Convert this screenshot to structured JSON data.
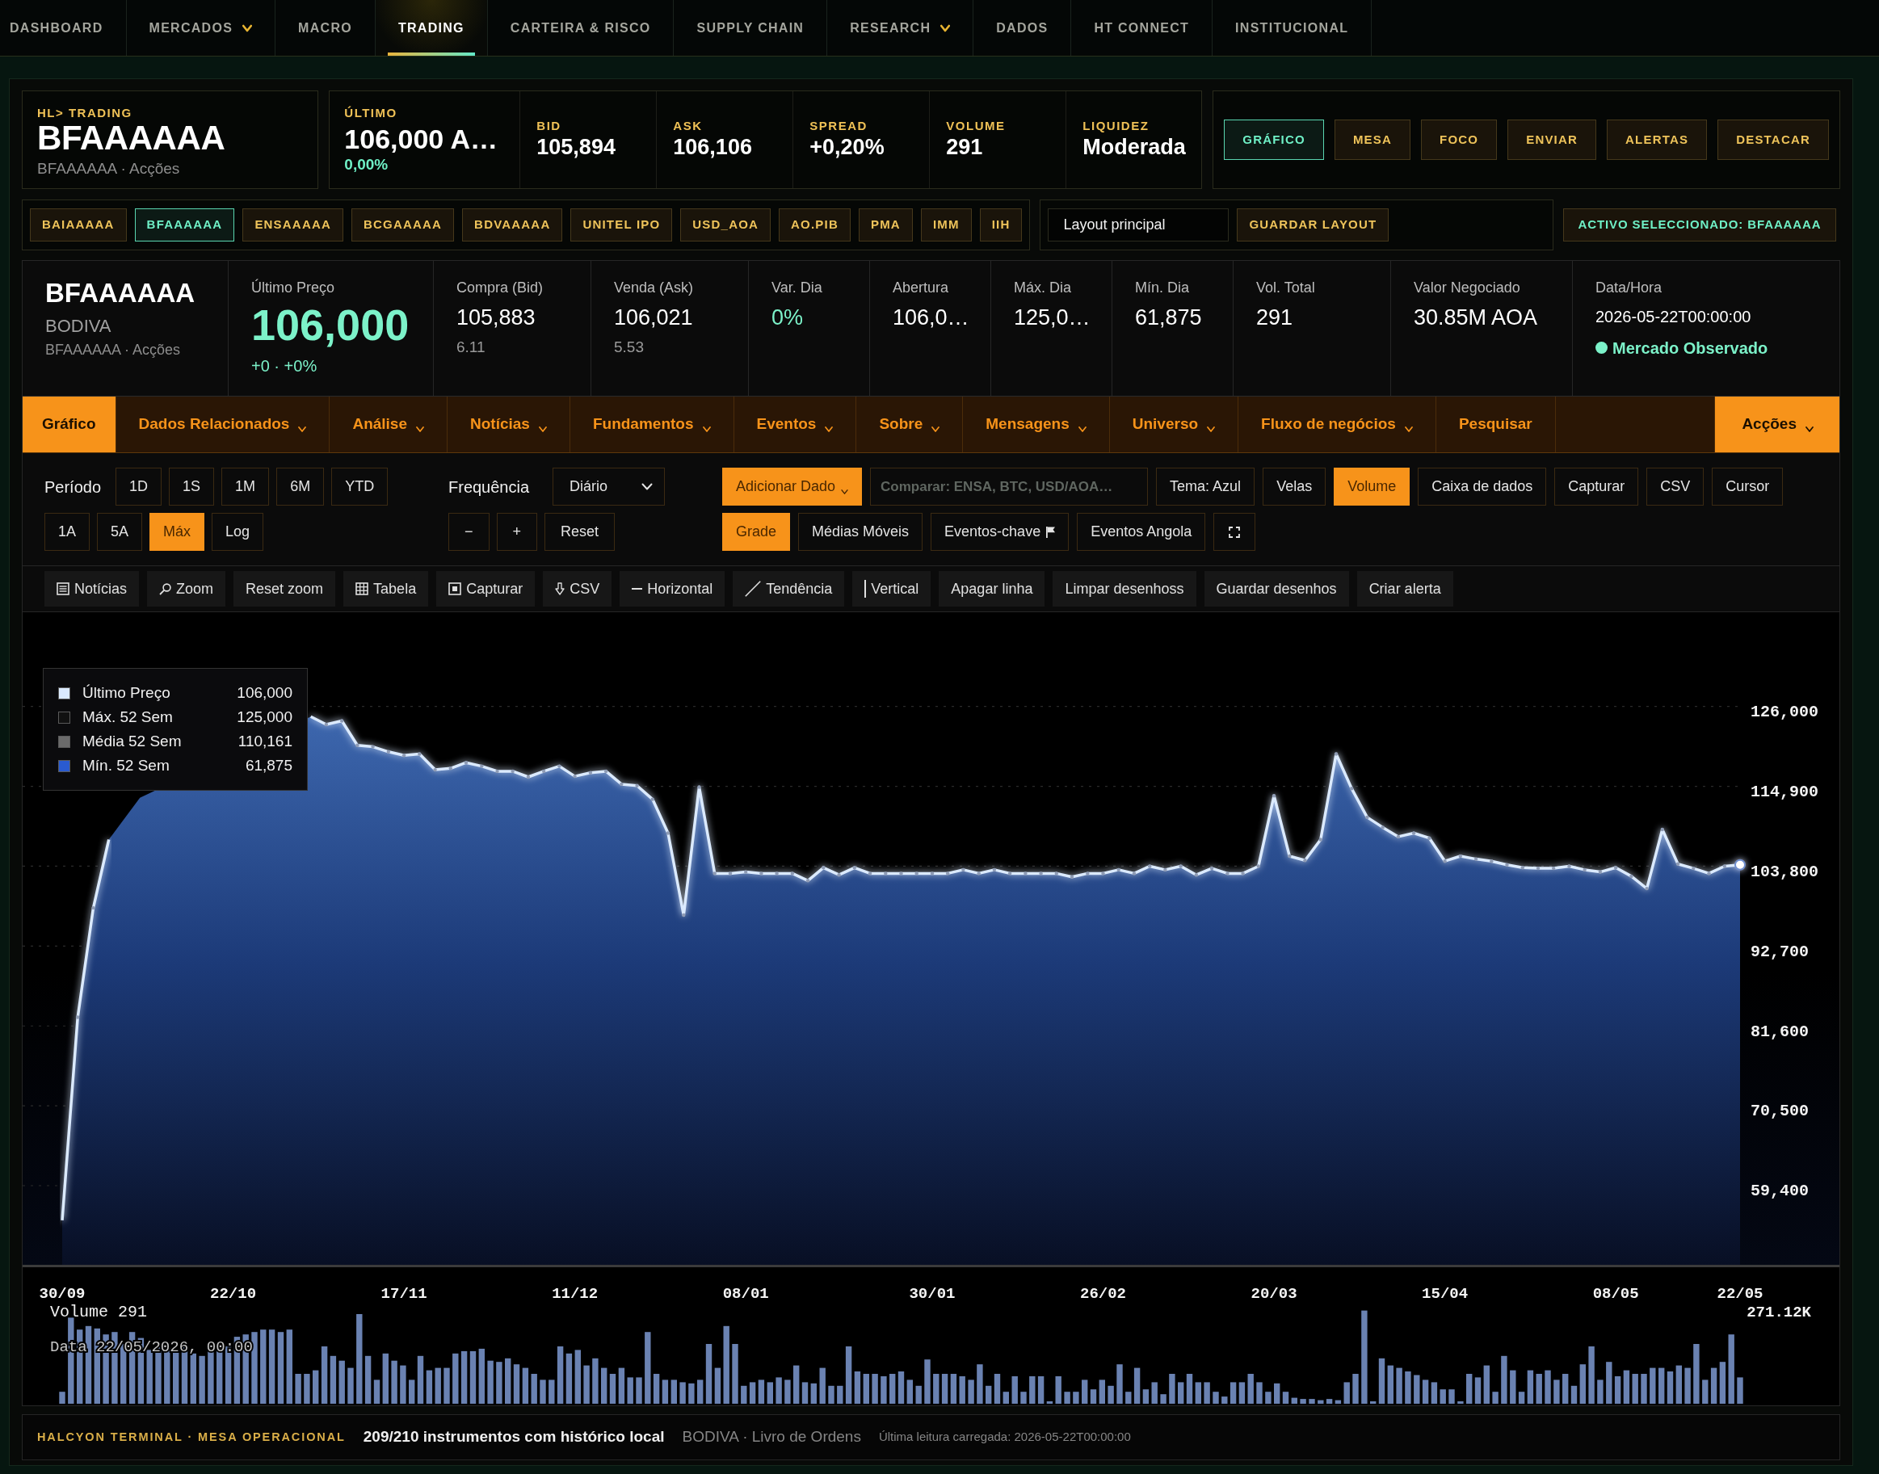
{
  "nav": [
    {
      "label": "DASHBOARD",
      "selected": false,
      "dropdown": false
    },
    {
      "label": "MERCADOS",
      "selected": false,
      "dropdown": true
    },
    {
      "label": "MACRO",
      "selected": false,
      "dropdown": false
    },
    {
      "label": "TRADING",
      "selected": true,
      "dropdown": false
    },
    {
      "label": "CARTEIRA & RISCO",
      "selected": false,
      "dropdown": false
    },
    {
      "label": "SUPPLY CHAIN",
      "selected": false,
      "dropdown": false
    },
    {
      "label": "RESEARCH",
      "selected": false,
      "dropdown": true
    },
    {
      "label": "DADOS",
      "selected": false,
      "dropdown": false
    },
    {
      "label": "HT CONNECT",
      "selected": false,
      "dropdown": false
    },
    {
      "label": "INSTITUCIONAL",
      "selected": false,
      "dropdown": false
    }
  ],
  "header": {
    "kicker": "HL> TRADING",
    "symbol": "BFAAAAAA",
    "subtitle": "BFAAAAAA · Acções"
  },
  "quote": [
    {
      "kind": "main",
      "label": "ÚLTIMO",
      "value": "106,000 A…",
      "change": "0,00%"
    },
    {
      "kind": "plain",
      "label": "BID",
      "value": "105,894"
    },
    {
      "kind": "plain",
      "label": "ASK",
      "value": "106,106"
    },
    {
      "kind": "plain",
      "label": "SPREAD",
      "value": "+0,20%"
    },
    {
      "kind": "plain",
      "label": "VOLUME",
      "value": "291"
    },
    {
      "kind": "plain",
      "label": "LIQUIDEZ",
      "value": "Moderada"
    }
  ],
  "view_buttons": [
    {
      "label": "GRÁFICO",
      "selected": true
    },
    {
      "label": "MESA",
      "selected": false
    },
    {
      "label": "FOCO",
      "selected": false
    },
    {
      "label": "ENVIAR",
      "selected": false
    },
    {
      "label": "ALERTAS",
      "selected": false
    },
    {
      "label": "DESTACAR",
      "selected": false
    }
  ],
  "tickers": [
    {
      "label": "BAIAAAAA",
      "selected": false
    },
    {
      "label": "BFAAAAAA",
      "selected": true
    },
    {
      "label": "ENSAAAAA",
      "selected": false
    },
    {
      "label": "BCGAAAAA",
      "selected": false
    },
    {
      "label": "BDVAAAAA",
      "selected": false
    },
    {
      "label": "UNITEL IPO",
      "selected": false
    },
    {
      "label": "USD_AOA",
      "selected": false
    },
    {
      "label": "AO.PIB",
      "selected": false
    },
    {
      "label": "PMA",
      "selected": false
    },
    {
      "label": "IMM",
      "selected": false
    },
    {
      "label": "IIH",
      "selected": false
    }
  ],
  "layout": {
    "name_field": {
      "value": "Layout principal"
    },
    "save_button": "GUARDAR LAYOUT"
  },
  "selected_asset": "ACTIVO SELECCIONADO: BFAAAAAA",
  "instrument": {
    "symbol": "BFAAAAAA",
    "exchange": "BODIVA",
    "subtitle": "BFAAAAAA · Acções"
  },
  "stats": [
    {
      "kind": "price",
      "label": "Último Preço",
      "value": "106,000",
      "sub": "+0 · +0%"
    },
    {
      "kind": "plain",
      "label": "Compra (Bid)",
      "value": "105,883",
      "sub": "6.11"
    },
    {
      "kind": "plain",
      "label": "Venda (Ask)",
      "value": "106,021",
      "sub": "5.53"
    },
    {
      "kind": "change",
      "label": "Var. Dia",
      "value": "0%"
    },
    {
      "kind": "plain",
      "label": "Abertura",
      "value": "106,0…"
    },
    {
      "kind": "plain",
      "label": "Máx. Dia",
      "value": "125,0…"
    },
    {
      "kind": "plain",
      "label": "Mín. Dia",
      "value": "61,875"
    },
    {
      "kind": "plain",
      "label": "Vol. Total",
      "value": "291"
    },
    {
      "kind": "plain",
      "label": "Valor Negociado",
      "value": "30.85M AOA"
    },
    {
      "kind": "datetime",
      "label": "Data/Hora",
      "value": "2026-05-22T00:00:00",
      "status": "Mercado Observado"
    }
  ],
  "tabs": [
    {
      "label": "Gráfico",
      "selected": true,
      "dropdown": false
    },
    {
      "label": "Dados Relacionados",
      "selected": false,
      "dropdown": true
    },
    {
      "label": "Análise",
      "selected": false,
      "dropdown": true
    },
    {
      "label": "Notícias",
      "selected": false,
      "dropdown": true
    },
    {
      "label": "Fundamentos",
      "selected": false,
      "dropdown": true
    },
    {
      "label": "Eventos",
      "selected": false,
      "dropdown": true
    },
    {
      "label": "Sobre",
      "selected": false,
      "dropdown": true
    },
    {
      "label": "Mensagens",
      "selected": false,
      "dropdown": true
    },
    {
      "label": "Universo",
      "selected": false,
      "dropdown": true
    },
    {
      "label": "Fluxo de negócios",
      "selected": false,
      "dropdown": true
    },
    {
      "label": "Pesquisar",
      "selected": false,
      "dropdown": false
    }
  ],
  "actions_menu": {
    "label": "Acções",
    "dropdown": true
  },
  "period": {
    "label": "Período",
    "options": [
      {
        "label": "1D",
        "selected": false
      },
      {
        "label": "1S",
        "selected": false
      },
      {
        "label": "1M",
        "selected": false
      },
      {
        "label": "6M",
        "selected": false
      },
      {
        "label": "YTD",
        "selected": false
      },
      {
        "label": "1A",
        "selected": false
      },
      {
        "label": "5A",
        "selected": false
      },
      {
        "label": "Máx",
        "selected": true
      },
      {
        "label": "Log",
        "selected": false
      }
    ]
  },
  "frequency": {
    "label": "Frequência",
    "value": "Diário",
    "buttons": [
      "−",
      "+",
      "Reset"
    ]
  },
  "chart_tools": {
    "add_data": {
      "label": "Adicionar Dado",
      "dropdown": true
    },
    "compare_field": {
      "placeholder": "Comparar: ENSA, BTC, USD/AOA…"
    },
    "toggles": [
      {
        "label": "Tema: Azul",
        "on": false
      },
      {
        "label": "Velas",
        "on": false
      },
      {
        "label": "Volume",
        "on": true
      },
      {
        "label": "Caixa de dados",
        "on": false
      },
      {
        "label": "Capturar",
        "on": false
      },
      {
        "label": "CSV",
        "on": false
      },
      {
        "label": "Cursor",
        "on": false
      }
    ],
    "overlays": [
      {
        "kind": "toggle",
        "label": "Grade",
        "on": true
      },
      {
        "kind": "toggle",
        "label": "Médias Móveis",
        "on": false
      },
      {
        "kind": "flag_toggle",
        "label": "Eventos-chave",
        "on": false
      },
      {
        "kind": "toggle",
        "label": "Eventos Angola",
        "on": false
      }
    ]
  },
  "drawing_toolbar": [
    "Notícias",
    "Zoom",
    "Reset zoom",
    "Tabela",
    "Capturar",
    "CSV",
    "Horizontal",
    "Tendência",
    "Vertical",
    "Apagar linha",
    "Limpar desenhoss",
    "Guardar desenhos",
    "Criar alerta"
  ],
  "chart": {
    "legend": [
      {
        "label": "Último Preço",
        "value": "106,000",
        "color": "#dbeafe"
      },
      {
        "label": "Máx. 52 Sem",
        "value": "125,000",
        "color": "#111111"
      },
      {
        "label": "Média 52 Sem",
        "value": "110,161",
        "color": "#6b6b6b"
      },
      {
        "label": "Mín. 52 Sem",
        "value": "61,875",
        "color": "#2a5bd0"
      }
    ],
    "chart_data": {
      "type": "area",
      "grid": true,
      "categories": [
        "30/09",
        null,
        null,
        null,
        null,
        null,
        null,
        null,
        null,
        null,
        null,
        "22/10",
        null,
        null,
        null,
        null,
        null,
        null,
        null,
        null,
        null,
        null,
        "17/11",
        null,
        null,
        null,
        null,
        null,
        null,
        null,
        null,
        null,
        null,
        "11/12",
        null,
        null,
        null,
        null,
        null,
        null,
        null,
        null,
        null,
        null,
        "08/01",
        null,
        null,
        null,
        null,
        null,
        null,
        null,
        null,
        null,
        null,
        null,
        "30/01",
        null,
        null,
        null,
        null,
        null,
        null,
        null,
        null,
        null,
        null,
        "26/02",
        null,
        null,
        null,
        null,
        null,
        null,
        null,
        null,
        null,
        null,
        "20/03",
        null,
        null,
        null,
        null,
        null,
        null,
        null,
        null,
        null,
        null,
        "15/04",
        null,
        null,
        null,
        null,
        null,
        null,
        null,
        null,
        null,
        null,
        "08/05",
        null,
        null,
        null,
        null,
        null,
        null,
        null,
        "22/05"
      ],
      "series": [
        {
          "color": "#dbeafe",
          "values": [
            54600,
            82800,
            98000,
            107500,
            null,
            113300,
            null,
            null,
            null,
            null,
            null,
            null,
            null,
            null,
            null,
            null,
            124600,
            123500,
            124000,
            120600,
            120400,
            119700,
            119200,
            119400,
            117200,
            117400,
            118200,
            117700,
            117000,
            117000,
            116200,
            117000,
            117700,
            116300,
            116800,
            117000,
            115200,
            115000,
            113100,
            108400,
            97000,
            114800,
            102800,
            102800,
            103000,
            102800,
            102800,
            102800,
            101800,
            103600,
            102600,
            103600,
            102800,
            102800,
            102800,
            102800,
            102800,
            102800,
            103300,
            102800,
            103300,
            102800,
            102800,
            102800,
            102800,
            102300,
            102800,
            102800,
            103300,
            102800,
            103800,
            103300,
            103800,
            102600,
            103500,
            102800,
            102800,
            103800,
            113600,
            105200,
            104600,
            107500,
            119400,
            114600,
            110600,
            109200,
            107900,
            108400,
            107700,
            104500,
            105200,
            104800,
            104500,
            104000,
            103600,
            103500,
            103500,
            103800,
            103300,
            103000,
            103600,
            102400,
            100700,
            108900,
            104100,
            103500,
            102800,
            103800,
            104000
          ]
        }
      ],
      "ylim": [
        48400,
        139100
      ],
      "yticks": [
        {
          "value": 126000,
          "label": "126,000"
        },
        {
          "value": 114900,
          "label": "114,900"
        },
        {
          "value": 103800,
          "label": "103,800"
        },
        {
          "value": 92700,
          "label": "92,700"
        },
        {
          "value": 81600,
          "label": "81,600"
        },
        {
          "value": 70500,
          "label": "70,500"
        },
        {
          "value": 59400,
          "label": "59,400"
        }
      ]
    },
    "volume": {
      "title": "Volume 291",
      "readout": "Data 22/05/2026, 00:00",
      "max_label": "271.12K"
    }
  },
  "footer": {
    "brand": "HALCYON TERMINAL · MESA OPERACIONAL",
    "coverage": "209/210 instrumentos com histórico local",
    "source": "BODIVA · Livro de Ordens",
    "last_read": "Última leitura carregada: 2026-05-22T00:00:00"
  }
}
